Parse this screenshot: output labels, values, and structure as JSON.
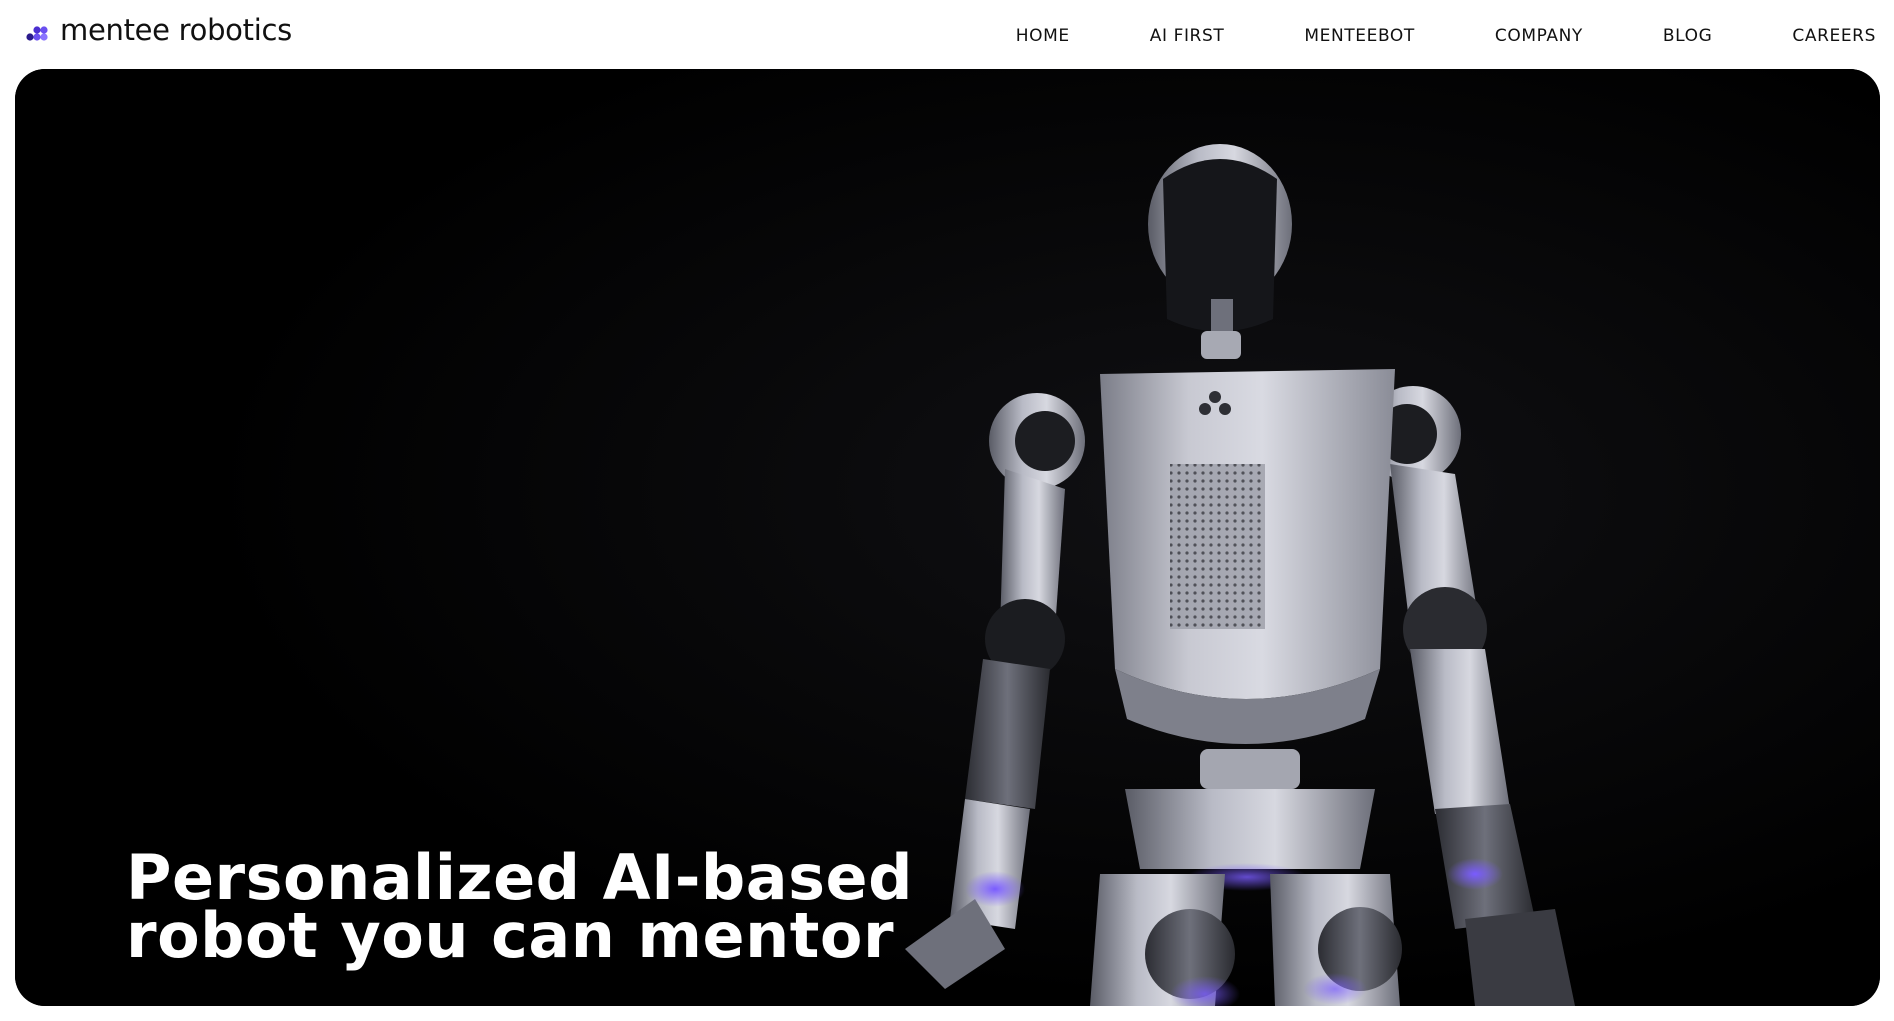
{
  "brand": {
    "name": "mentee robotics",
    "accent_color": "#5b3bdc",
    "logo_icon": "mentee-dots-logo-icon"
  },
  "nav": {
    "items": [
      {
        "label": "HOME"
      },
      {
        "label": "AI FIRST"
      },
      {
        "label": "MENTEEBOT"
      },
      {
        "label": "COMPANY"
      },
      {
        "label": "BLOG"
      },
      {
        "label": "CAREERS"
      }
    ]
  },
  "hero": {
    "headline_line1": "Personalized AI-based",
    "headline_line2": "robot you can mentor",
    "background_color": "#000000",
    "image": "humanoid-robot-photo"
  }
}
